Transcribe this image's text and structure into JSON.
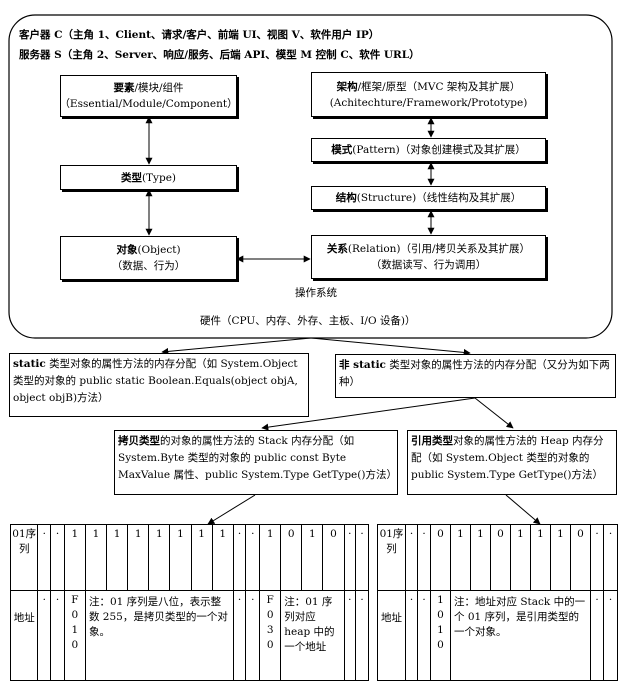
{
  "outer_panel": {
    "line1": "客户器 C（主角 1、Client、请求/客户、前端 UI、视图 V、软件用户 IP）",
    "line2": "服务器 S（主角 2、Server、响应/服务、后端 API、模型 M 控制 C、软件 URL）",
    "os_label": "操作系统",
    "hardware_label": "硬件（CPU、内存、外存、主板、I/O 设备)）"
  },
  "left_boxes": {
    "element": {
      "title": "要素",
      "rest": "/模块/组件",
      "sub": "（Essential/Module/Component）"
    },
    "type": {
      "title": "类型",
      "rest": "(Type)"
    },
    "object": {
      "title": "对象",
      "rest": "(Object)",
      "sub": "（数据、行为）"
    }
  },
  "right_boxes": {
    "architecture": {
      "title": "架构",
      "rest": "/框架/原型（MVC 架构及其扩展）",
      "sub": "(Achitechture/Framework/Prototype)"
    },
    "pattern": {
      "title": "模式",
      "rest": "(Pattern)（对象创建模式及其扩展）"
    },
    "structure": {
      "title": "结构",
      "rest": "(Structure)（线性结构及其扩展）"
    },
    "relation": {
      "title": "关系",
      "rest": "(Relation)（引用/拷贝关系及其扩展）",
      "sub": "（数据读写、行为调用）"
    }
  },
  "static_box": {
    "bold": "static",
    "text": " 类型对象的属性方法的内存分配（如 System.Object 类型的对象的 public static Boolean.Equals(object objA, object objB)方法）"
  },
  "nonstatic_box": {
    "bold": "非 static",
    "text": " 类型对象的属性方法的内存分配（又分为如下两种）"
  },
  "copy_type_box": {
    "bold": "拷贝类型",
    "text": "的对象的属性方法的 Stack 内存分配（如 System.Byte 类型的对象的 public const Byte MaxValue 属性、public System.Type GetType()方法）"
  },
  "ref_type_box": {
    "bold": "引用类型",
    "text": "对象的属性方法的 Heap 内存分配（如 System.Object 类型的对象的 public System.Type GetType()方法）"
  },
  "stack_table": {
    "header": "01序列",
    "row1": [
      "·",
      "·",
      "1",
      "1",
      "1",
      "1",
      "1",
      "1",
      "1",
      "1",
      "·",
      "·",
      "1",
      "0",
      "1",
      "0",
      "·",
      "·"
    ],
    "addr_label": "地址",
    "row2_left": [
      "·",
      "·",
      "F010"
    ],
    "note1": "注：01 序列是八位，表示整数 255，是拷贝类型的一个对象。",
    "row2_mid": [
      "·",
      "·",
      "F030"
    ],
    "note2": "注：01 序列对应 heap 中的一个地址",
    "row2_right": [
      "·",
      "·"
    ]
  },
  "heap_table": {
    "header": "01序列",
    "row1": [
      "·",
      "·",
      "0",
      "1",
      "1",
      "0",
      "1",
      "1",
      "1",
      "0",
      "·",
      "·"
    ],
    "addr_label": "地址",
    "row2_left": [
      "·",
      "·",
      "1010"
    ],
    "note": "注：地址对应 Stack 中的一个 01 序列，是引用类型的一个对象。",
    "row2_right": [
      "·",
      "·"
    ]
  }
}
